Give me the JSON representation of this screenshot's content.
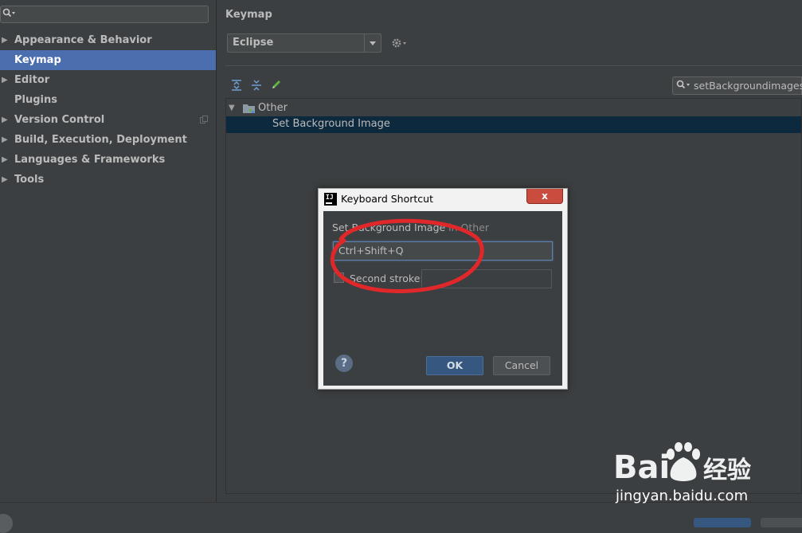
{
  "sidebar": {
    "search_placeholder": "",
    "items": [
      {
        "label": "Appearance & Behavior",
        "expandable": true,
        "selected": false
      },
      {
        "label": "Keymap",
        "expandable": false,
        "selected": true
      },
      {
        "label": "Editor",
        "expandable": true,
        "selected": false
      },
      {
        "label": "Plugins",
        "expandable": false,
        "selected": false
      },
      {
        "label": "Version Control",
        "expandable": true,
        "selected": false
      },
      {
        "label": "Build, Execution, Deployment",
        "expandable": true,
        "selected": false
      },
      {
        "label": "Languages & Frameworks",
        "expandable": true,
        "selected": false
      },
      {
        "label": "Tools",
        "expandable": true,
        "selected": false
      }
    ]
  },
  "main": {
    "title": "Keymap",
    "scheme": "Eclipse",
    "search_value": "setBackgroundimages",
    "tree": {
      "group": "Other",
      "action": "Set Background Image"
    }
  },
  "dialog": {
    "title": "Keyboard Shortcut",
    "close_label": "x",
    "desc_prefix": "Set Background Image",
    "desc_in": " in Other",
    "shortcut_value": "Ctrl+Shift+Q",
    "second_stroke_label": "Second stroke:",
    "second_stroke_checked": false,
    "help_label": "?",
    "ok_label": "OK",
    "cancel_label": "Cancel"
  },
  "watermark": {
    "brand": "Baidu经验",
    "url": "jingyan.baidu.com"
  },
  "colors": {
    "background": "#3c3f41",
    "selection": "#4b6eaf",
    "tree_selection": "#0d293e",
    "ok_button": "#365880",
    "annotation": "#e0282a"
  },
  "icons": {
    "search": "search-icon",
    "gear": "gear-icon",
    "expand_all": "expand-all-icon",
    "collapse_all": "collapse-all-icon",
    "edit": "pencil-icon",
    "folder": "folder-icon",
    "copy": "copy-icon",
    "app": "intellij-icon"
  }
}
